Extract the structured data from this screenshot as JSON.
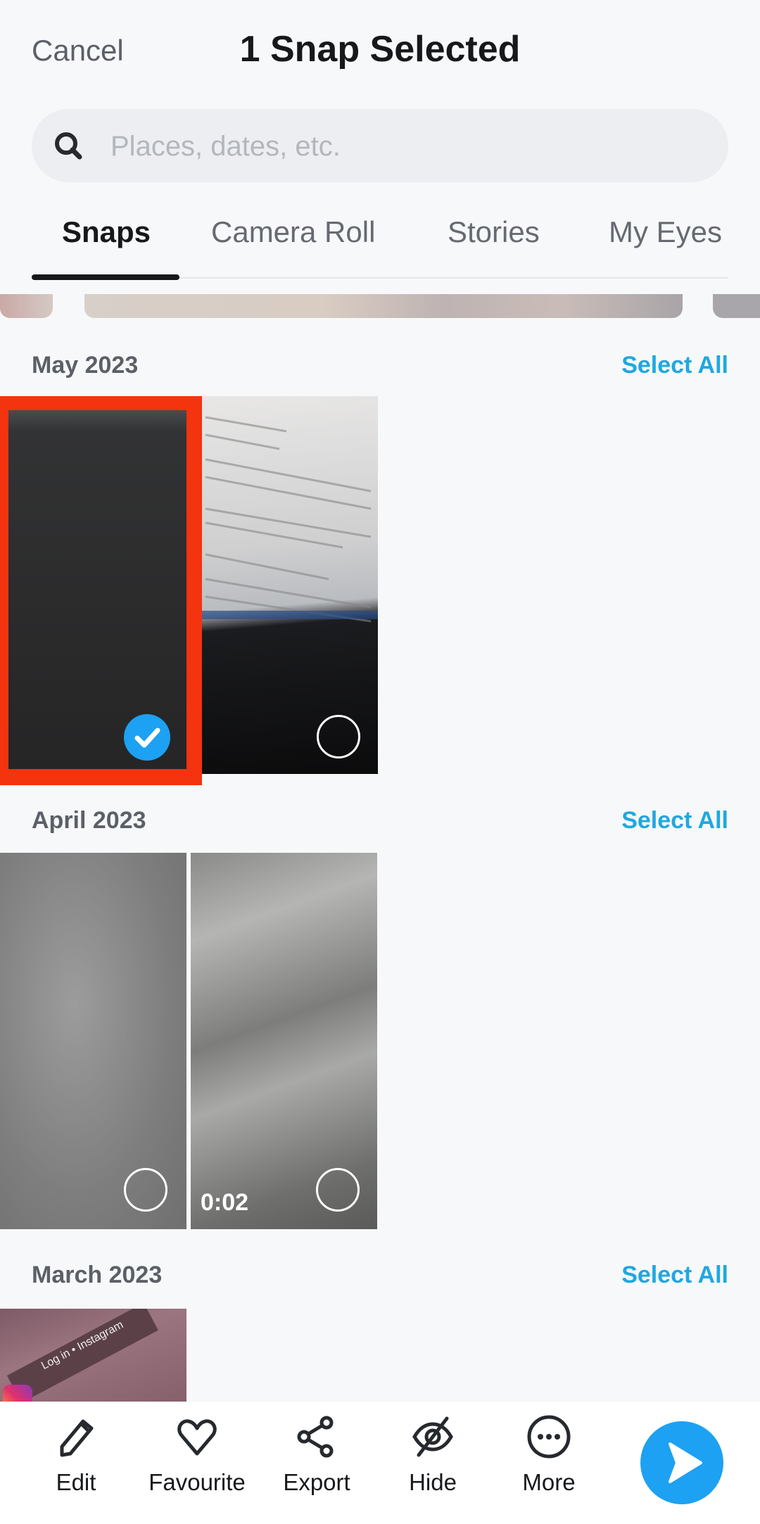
{
  "header": {
    "cancel_label": "Cancel",
    "title": "1 Snap Selected"
  },
  "search": {
    "placeholder": "Places, dates, etc.",
    "value": "",
    "icon": "search-icon"
  },
  "tabs": [
    {
      "label": "Snaps",
      "active": true
    },
    {
      "label": "Camera Roll",
      "active": false
    },
    {
      "label": "Stories",
      "active": false
    },
    {
      "label": "My Eyes",
      "active": false
    }
  ],
  "sections": [
    {
      "month": "May 2023",
      "select_all_label": "Select All",
      "items": [
        {
          "type": "photo",
          "selected": true,
          "highlighted": true
        },
        {
          "type": "photo",
          "selected": false
        }
      ]
    },
    {
      "month": "April 2023",
      "select_all_label": "Select All",
      "items": [
        {
          "type": "photo",
          "selected": false
        },
        {
          "type": "video",
          "duration": "0:02",
          "selected": false
        }
      ]
    },
    {
      "month": "March 2023",
      "select_all_label": "Select All",
      "items": [
        {
          "type": "photo",
          "selected": false,
          "caption_text": "Log in • Instagram"
        }
      ]
    }
  ],
  "bottom_bar": {
    "actions": [
      {
        "label": "Edit",
        "icon": "pencil-icon"
      },
      {
        "label": "Favourite",
        "icon": "heart-icon"
      },
      {
        "label": "Export",
        "icon": "share-icon"
      },
      {
        "label": "Hide",
        "icon": "eye-slash-icon"
      },
      {
        "label": "More",
        "icon": "more-icon"
      }
    ],
    "send_icon": "send-arrow-icon"
  },
  "colors": {
    "accent": "#1da1f2",
    "select_all": "#1fa8e0",
    "highlight_box": "#f4330f",
    "background": "#f7f8f9"
  }
}
